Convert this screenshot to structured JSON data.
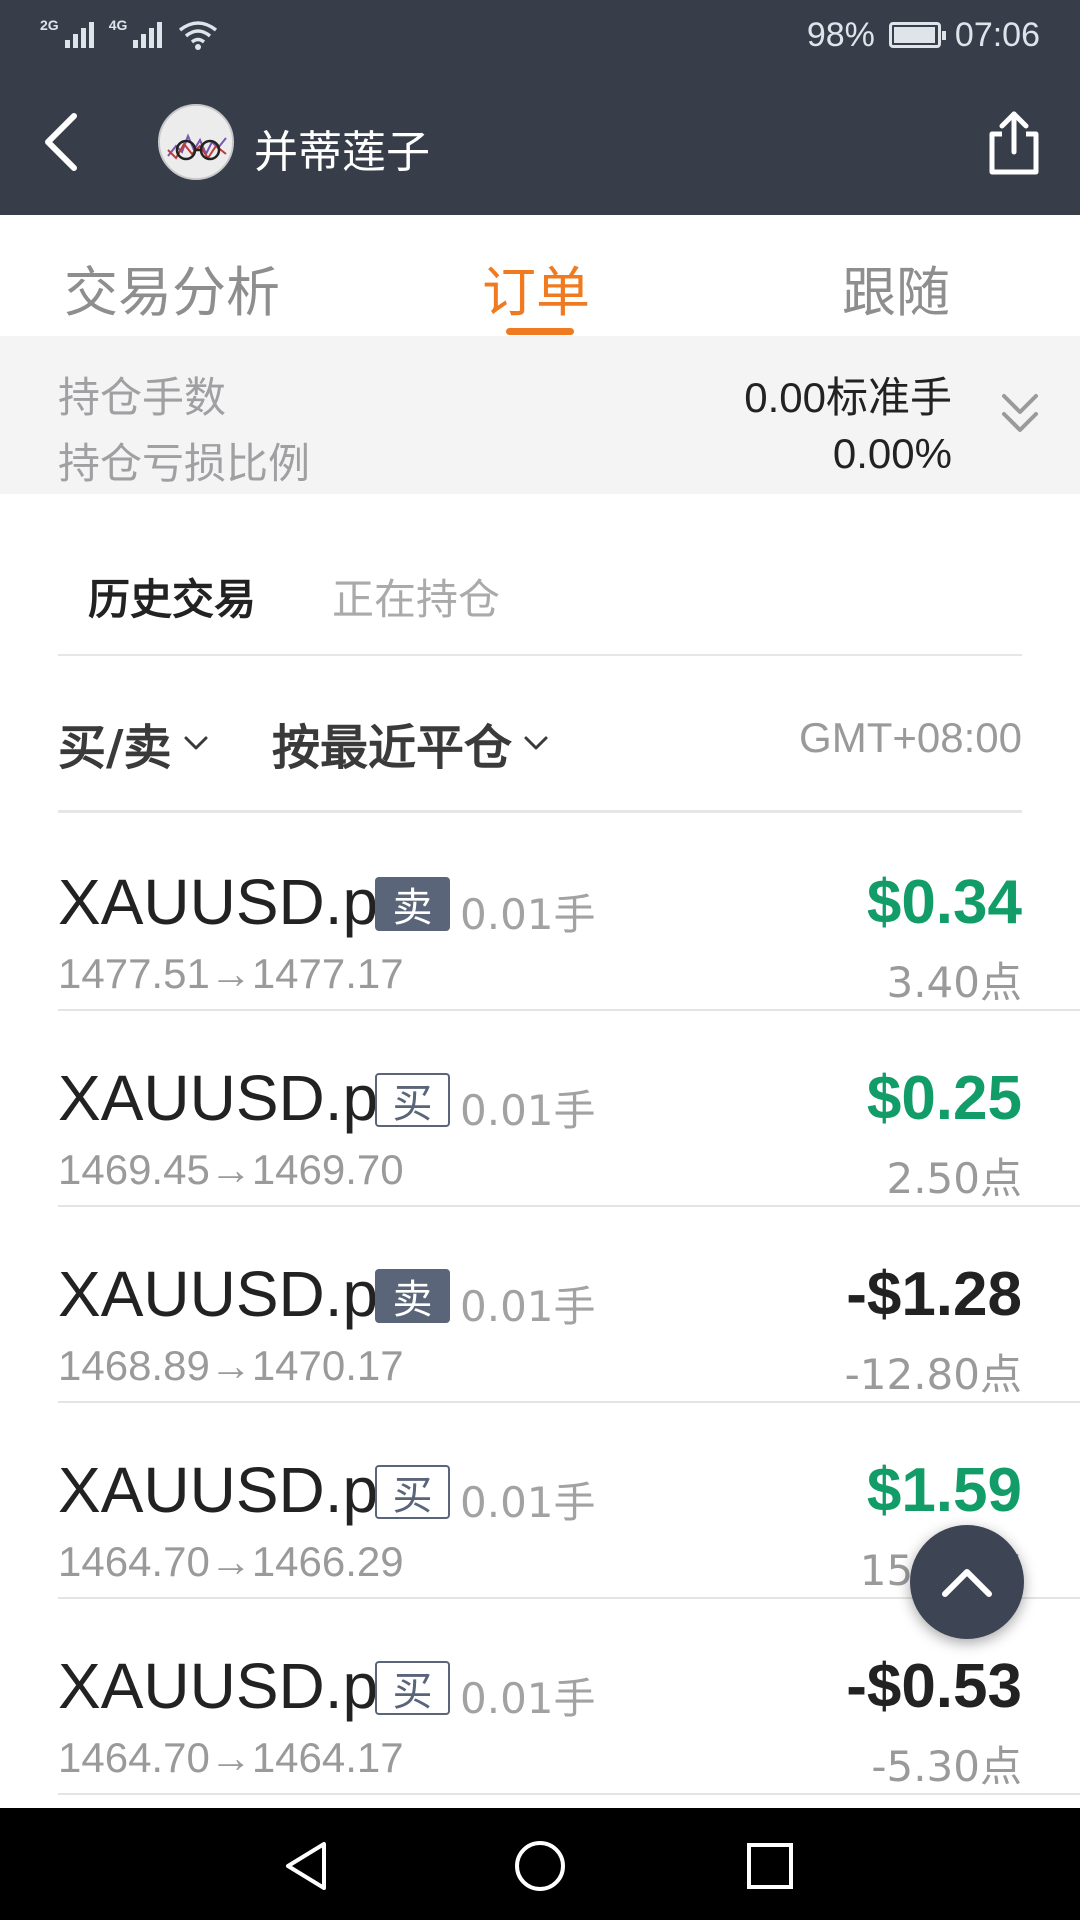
{
  "status_bar": {
    "net1": "2G",
    "net2": "4G",
    "battery_percent": "98%",
    "battery_level": 0.98,
    "time": "07:06"
  },
  "header": {
    "title": "并蒂莲子"
  },
  "tabs": [
    {
      "label": "交易分析",
      "active": false
    },
    {
      "label": "订单",
      "active": true
    },
    {
      "label": "跟随",
      "active": false
    }
  ],
  "summary": {
    "lots_label": "持仓手数",
    "lots_value": "0.00标准手",
    "ratio_label": "持仓亏损比例",
    "ratio_value": "0.00%"
  },
  "subtabs": {
    "history": "历史交易",
    "holding": "正在持仓"
  },
  "filters": {
    "side": "买/卖",
    "sort": "按最近平仓",
    "timezone": "GMT+08:00"
  },
  "orders": [
    {
      "symbol": "XAUUSD.p",
      "side": "卖",
      "lots": "0.01手",
      "prices": "1477.51→1477.17",
      "profit": "$0.34",
      "points": "3.40点"
    },
    {
      "symbol": "XAUUSD.p",
      "side": "买",
      "lots": "0.01手",
      "prices": "1469.45→1469.70",
      "profit": "$0.25",
      "points": "2.50点"
    },
    {
      "symbol": "XAUUSD.p",
      "side": "卖",
      "lots": "0.01手",
      "prices": "1468.89→1470.17",
      "profit": "-$1.28",
      "points": "-12.80点"
    },
    {
      "symbol": "XAUUSD.p",
      "side": "买",
      "lots": "0.01手",
      "prices": "1464.70→1466.29",
      "profit": "$1.59",
      "points": "15.90点"
    },
    {
      "symbol": "XAUUSD.p",
      "side": "买",
      "lots": "0.01手",
      "prices": "1464.70→1464.17",
      "profit": "-$0.53",
      "points": "-5.30点"
    }
  ],
  "colors": {
    "header_bg": "#373e4a",
    "accent": "#f07a1f",
    "profit_positive": "#119c68",
    "profit_negative": "#222222",
    "badge": "#5a657a"
  },
  "icons": {
    "back": "chevron-left-icon",
    "share": "share-icon",
    "expand": "double-chevron-down-icon",
    "scroll_top": "chevron-up-icon",
    "sys_back": "triangle-back-icon",
    "sys_home": "circle-home-icon",
    "sys_recent": "square-recent-icon"
  }
}
